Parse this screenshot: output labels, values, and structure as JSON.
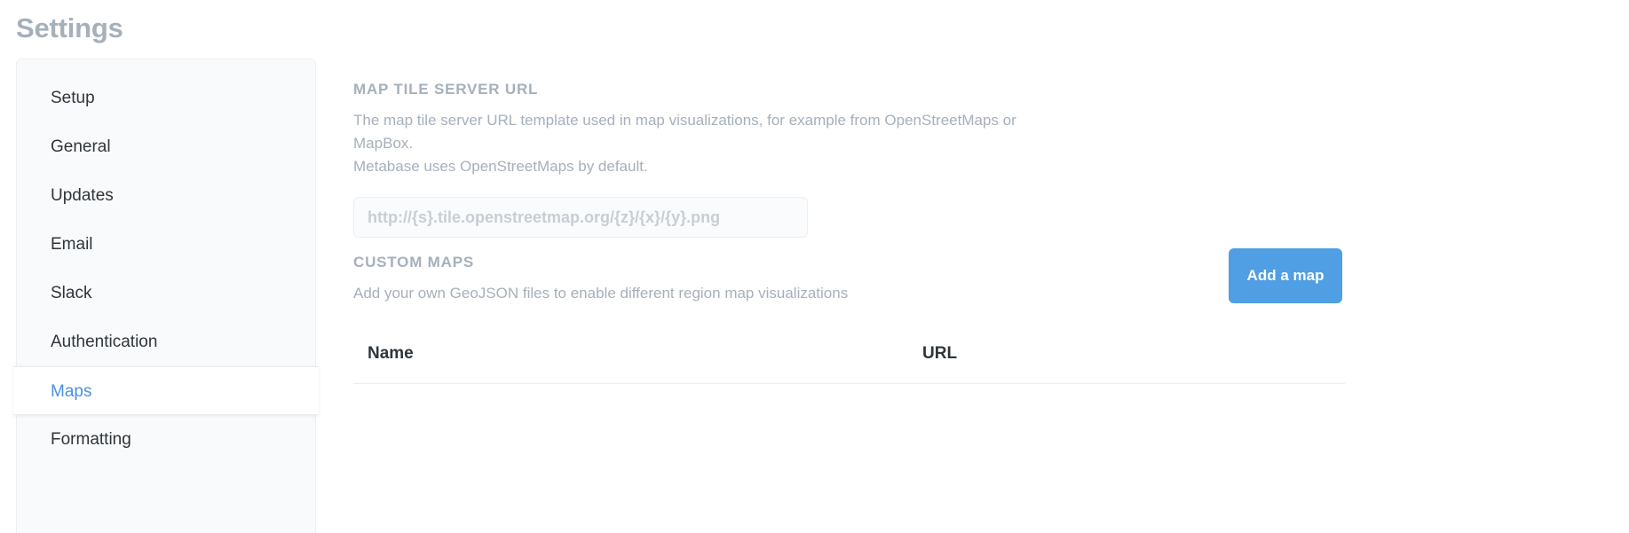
{
  "page": {
    "title": "Settings"
  },
  "sidebar": {
    "items": [
      {
        "label": "Setup",
        "active": false
      },
      {
        "label": "General",
        "active": false
      },
      {
        "label": "Updates",
        "active": false
      },
      {
        "label": "Email",
        "active": false
      },
      {
        "label": "Slack",
        "active": false
      },
      {
        "label": "Authentication",
        "active": false
      },
      {
        "label": "Maps",
        "active": true
      },
      {
        "label": "Formatting",
        "active": false
      }
    ]
  },
  "main": {
    "tile_server": {
      "heading": "MAP TILE SERVER URL",
      "description_line1": "The map tile server URL template used in map visualizations, for example from OpenStreetMaps or MapBox.",
      "description_line2": "Metabase uses OpenStreetMaps by default.",
      "input_value": "",
      "input_placeholder": "http://{s}.tile.openstreetmap.org/{z}/{x}/{y}.png"
    },
    "custom_maps": {
      "heading": "CUSTOM MAPS",
      "description": "Add your own GeoJSON files to enable different region map visualizations",
      "add_button_label": "Add a map",
      "table": {
        "columns": [
          "Name",
          "URL"
        ],
        "rows": []
      }
    }
  },
  "colors": {
    "accent_blue": "#509ee3",
    "active_link": "#4a90e2",
    "muted_text": "#a6b0bb",
    "body_text": "#2e353b",
    "sidebar_bg": "#f9fafb",
    "input_bg": "#fafbfc"
  }
}
